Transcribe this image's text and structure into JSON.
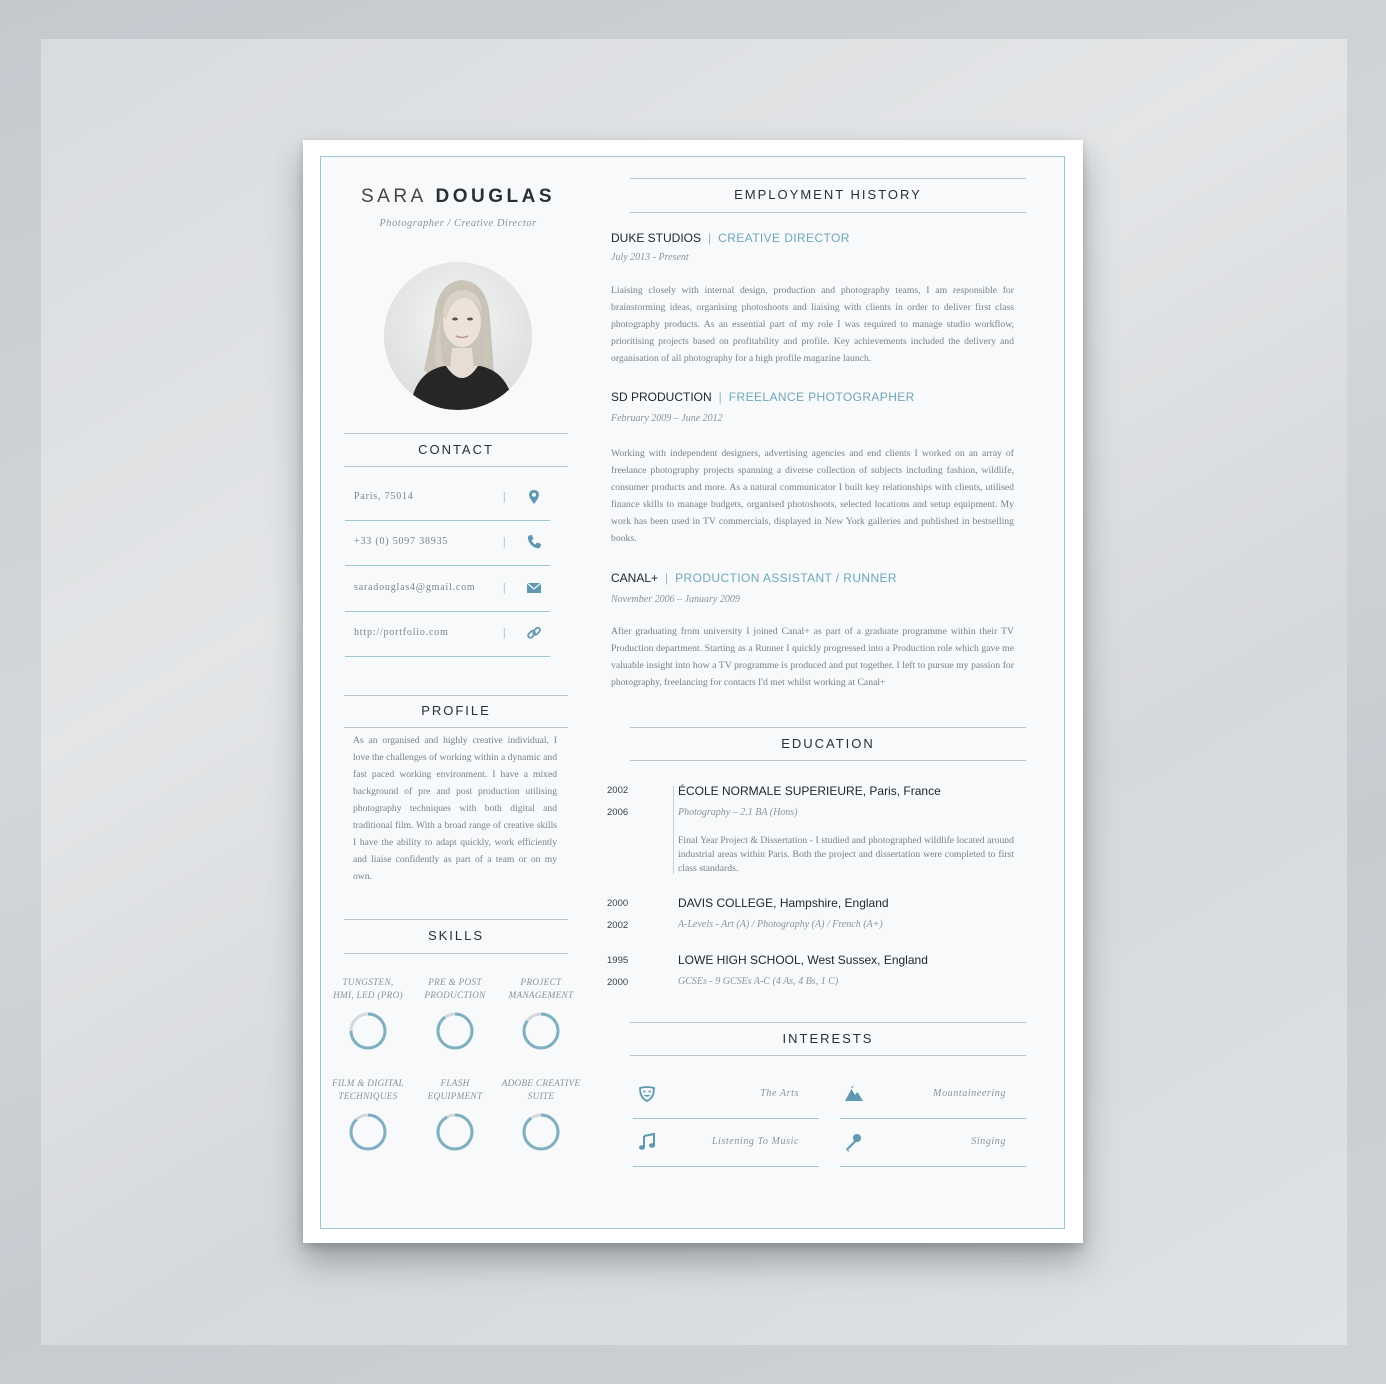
{
  "header": {
    "first_name": "SARA",
    "last_name": "DOUGLAS",
    "subtitle": "Photographer / Creative Director"
  },
  "contact": {
    "title": "CONTACT",
    "items": [
      {
        "text": "Paris, 75014",
        "icon": "location-pin-icon"
      },
      {
        "text": "+33 (0) 5097 38935",
        "icon": "phone-icon"
      },
      {
        "text": "saradouglas4@gmail.com",
        "icon": "envelope-icon"
      },
      {
        "text": "http://portfolio.com",
        "icon": "link-icon"
      }
    ],
    "separator": "|"
  },
  "profile": {
    "title": "PROFILE",
    "text": "As an organised and highly creative individual, I love the challenges of working within a dynamic and fast paced working environment. I have a mixed background of pre and post production utilising photography techniques with both digital and traditional film. With a broad range of creative skills I have the ability to adapt quickly, work efficiently and liaise confidently as part of a team or on my own."
  },
  "skills": {
    "title": "SKILLS",
    "items": [
      {
        "line1": "TUNGSTEN,",
        "line2": "HMI, LED (PRO)",
        "level": 0.75
      },
      {
        "line1": "PRE & POST",
        "line2": "PRODUCTION",
        "level": 0.9
      },
      {
        "line1": "PROJECT",
        "line2": "MANAGEMENT",
        "level": 0.85
      },
      {
        "line1": "FILM & DIGITAL",
        "line2": "TECHNIQUES",
        "level": 0.88
      },
      {
        "line1": "FLASH",
        "line2": "EQUIPMENT",
        "level": 0.92
      },
      {
        "line1": "ADOBE CREATIVE",
        "line2": "SUITE",
        "level": 0.9
      }
    ],
    "colors": {
      "fill": "#7fb0c2",
      "track": "#d4d8db"
    }
  },
  "employment": {
    "title": "EMPLOYMENT HISTORY",
    "jobs": [
      {
        "company": "DUKE STUDIOS",
        "role": "CREATIVE DIRECTOR",
        "dates": "July 2013 - Present",
        "text": "Liaising closely with internal design, production and photography teams, I am responsible for brainstorming ideas, organising photoshoots and liaising with clients in order to deliver first class photography products.  As an essential part of my role I was required to manage studio workflow, prioritising projects based on profitability and profile.  Key achievements included the delivery and organisation of all photography for a high profile magazine launch."
      },
      {
        "company": "SD PRODUCTION",
        "role": "FREELANCE PHOTOGRAPHER",
        "dates": "February 2009 – June 2012",
        "text": "Working with independent designers, advertising agencies and end clients I worked on an array of freelance photography projects spanning a diverse collection of subjects including fashion, wildlife, consumer products and more.  As a natural communicator I built key relationships with clients, utilised finance skills to manage budgets, organised photoshoots, selected locations and setup equipment.   My work has been used in TV commercials, displayed in New York galleries and published in bestselling books."
      },
      {
        "company": "CANAL+",
        "role": "PRODUCTION ASSISTANT / RUNNER",
        "dates": "November 2006 – January 2009",
        "text": "After graduating from university I joined Canal+ as part of a graduate programme within their TV Production department.  Starting as a Runner I quickly progressed into a Production role which gave me valuable insight into how a TV programme is produced and put together. I left to pursue my passion for photography, freelancing for contacts I'd met whilst working at Canal+"
      }
    ]
  },
  "education": {
    "title": "EDUCATION",
    "items": [
      {
        "start": "2002",
        "end": "2006",
        "school": "ÉCOLE NORMALE SUPERIEURE",
        "location": ", Paris, France",
        "detail": "Photography – 2.1 BA (Hons)",
        "text": "Final Year Project & Dissertation - I studied and photographed wildlife located around industrial areas within Paris. Both the project and dissertation were completed to first class standards."
      },
      {
        "start": "2000",
        "end": "2002",
        "school": "DAVIS COLLEGE",
        "location": ", Hampshire, England",
        "detail": "A-Levels - Art (A) / Photography (A) / French (A+)"
      },
      {
        "start": "1995",
        "end": "2000",
        "school": "LOWE HIGH SCHOOL",
        "location": ", West Sussex, England",
        "detail": "GCSEs - 9 GCSEs A-C (4 As, 4 Bs, 1 C)"
      }
    ]
  },
  "interests": {
    "title": "INTERESTS",
    "items": [
      {
        "label": "The Arts",
        "icon": "theatre-mask-icon"
      },
      {
        "label": "Mountaineering",
        "icon": "mountain-icon"
      },
      {
        "label": "Listening To Music",
        "icon": "music-note-icon"
      },
      {
        "label": "Singing",
        "icon": "microphone-icon"
      }
    ]
  },
  "colors": {
    "accent": "#6fa6bd",
    "icon": "#5f98b0",
    "text": "#22272b"
  }
}
